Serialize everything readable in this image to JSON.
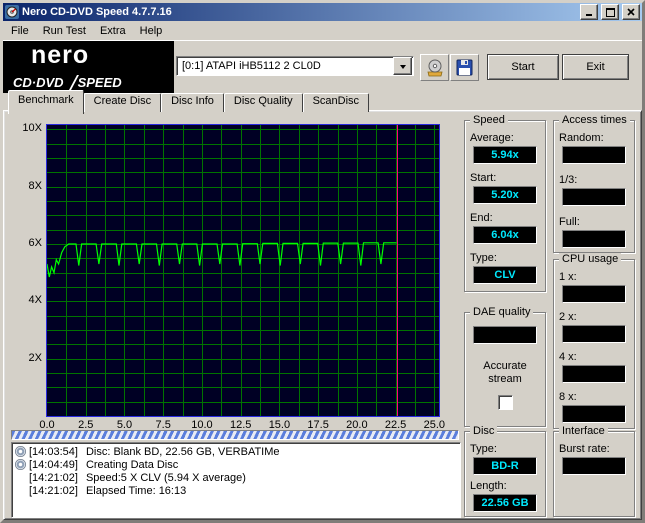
{
  "window": {
    "title": "Nero CD-DVD Speed 4.7.7.16"
  },
  "menu": {
    "items": [
      "File",
      "Run Test",
      "Extra",
      "Help"
    ]
  },
  "toolbar": {
    "logo": {
      "brand": "nero",
      "product_left": "CD·DVD",
      "product_right": "SPEED"
    },
    "drive_select": {
      "value": "[0:1]  ATAPI iHB5112  2 CL0D"
    },
    "buttons": {
      "start": "Start",
      "exit": "Exit"
    }
  },
  "tabs": [
    {
      "label": "Benchmark",
      "active": true
    },
    {
      "label": "Create Disc",
      "active": false
    },
    {
      "label": "Disc Info",
      "active": false
    },
    {
      "label": "Disc Quality",
      "active": false
    },
    {
      "label": "ScanDisc",
      "active": false
    }
  ],
  "chart_data": {
    "type": "line",
    "title": "",
    "xlabel": "",
    "ylabel": "",
    "xlim": [
      0,
      25.3
    ],
    "ylim": [
      0,
      10.15
    ],
    "x_ticks": [
      "0.0",
      "2.5",
      "5.0",
      "7.5",
      "10.0",
      "12.5",
      "15.0",
      "17.5",
      "20.0",
      "22.5",
      "25.0"
    ],
    "x_tick_values": [
      0,
      2.5,
      5,
      7.5,
      10,
      12.5,
      15,
      17.5,
      20,
      22.5,
      25
    ],
    "y_ticks": [
      "10X",
      "8X",
      "6X",
      "4X",
      "2X"
    ],
    "y_tick_values": [
      10,
      8,
      6,
      4,
      2
    ],
    "grid": {
      "x_step": 1.25,
      "y_step": 0.5,
      "on": true
    },
    "colors": {
      "bg": "#000024",
      "grid": "#007400",
      "marker": "#ff0080",
      "border": "#2a2ae0"
    },
    "marker_x": 22.56,
    "series": [
      {
        "name": "read speed (x)",
        "color": "#00ff00",
        "points": [
          [
            0,
            5.3
          ],
          [
            0.15,
            4.85
          ],
          [
            0.3,
            5.2
          ],
          [
            0.45,
            5.0
          ],
          [
            0.6,
            5.45
          ],
          [
            0.75,
            5.3
          ],
          [
            0.95,
            5.7
          ],
          [
            1.15,
            5.9
          ],
          [
            1.4,
            6.0
          ],
          [
            1.87,
            6.0
          ],
          [
            2.05,
            5.25
          ],
          [
            2.23,
            6.0
          ],
          [
            3.17,
            6.0
          ],
          [
            3.35,
            5.3
          ],
          [
            3.53,
            6.0
          ],
          [
            4.47,
            6.0
          ],
          [
            4.65,
            5.25
          ],
          [
            4.83,
            6.0
          ],
          [
            5.77,
            6.0
          ],
          [
            5.95,
            5.3
          ],
          [
            6.13,
            6.0
          ],
          [
            7.07,
            6.0
          ],
          [
            7.25,
            5.25
          ],
          [
            7.43,
            6.0
          ],
          [
            8.37,
            6.0
          ],
          [
            8.55,
            5.3
          ],
          [
            8.73,
            6.0
          ],
          [
            9.67,
            6.0
          ],
          [
            9.85,
            5.25
          ],
          [
            10.03,
            6.0
          ],
          [
            10.97,
            6.0
          ],
          [
            11.15,
            5.3
          ],
          [
            11.33,
            6.0
          ],
          [
            12.27,
            6.0
          ],
          [
            12.45,
            5.25
          ],
          [
            12.63,
            6.01
          ],
          [
            13.57,
            6.01
          ],
          [
            13.75,
            5.3
          ],
          [
            13.93,
            6.02
          ],
          [
            14.87,
            6.02
          ],
          [
            15.05,
            5.25
          ],
          [
            15.23,
            6.02
          ],
          [
            16.17,
            6.02
          ],
          [
            16.35,
            5.3
          ],
          [
            16.53,
            6.02
          ],
          [
            17.47,
            6.02
          ],
          [
            17.65,
            5.25
          ],
          [
            17.83,
            6.03
          ],
          [
            18.77,
            6.03
          ],
          [
            18.95,
            5.3
          ],
          [
            19.13,
            6.03
          ],
          [
            20.07,
            6.03
          ],
          [
            20.25,
            5.25
          ],
          [
            20.43,
            6.04
          ],
          [
            21.37,
            6.04
          ],
          [
            21.55,
            5.3
          ],
          [
            21.73,
            6.04
          ],
          [
            22.2,
            6.04
          ],
          [
            22.56,
            6.04
          ]
        ]
      }
    ]
  },
  "panels": {
    "speed": {
      "title": "Speed",
      "fields": [
        {
          "label": "Average:",
          "value": "5.94x"
        },
        {
          "label": "Start:",
          "value": "5.20x"
        },
        {
          "label": "End:",
          "value": "6.04x"
        },
        {
          "label": "Type:",
          "value": "CLV"
        }
      ]
    },
    "access_times": {
      "title": "Access times",
      "fields": [
        {
          "label": "Random:",
          "value": ""
        },
        {
          "label": "1/3:",
          "value": ""
        },
        {
          "label": "Full:",
          "value": ""
        }
      ]
    },
    "cpu_usage": {
      "title": "CPU usage",
      "fields": [
        {
          "label": "1 x:",
          "value": ""
        },
        {
          "label": "2 x:",
          "value": ""
        },
        {
          "label": "4 x:",
          "value": ""
        },
        {
          "label": "8 x:",
          "value": ""
        }
      ]
    },
    "dae_quality": {
      "title": "DAE quality",
      "value": "",
      "accurate_stream_label": "Accurate stream",
      "accurate_stream_checked": false
    },
    "disc": {
      "title": "Disc",
      "fields": [
        {
          "label": "Type:",
          "value": "BD-R"
        },
        {
          "label": "Length:",
          "value": "22.56 GB"
        }
      ]
    },
    "interface": {
      "title": "Interface",
      "fields": [
        {
          "label": "Burst rate:",
          "value": ""
        }
      ]
    }
  },
  "log": {
    "lines": [
      {
        "icon": true,
        "time": "[14:03:54]",
        "text": "Disc: Blank BD, 22.56 GB, VERBATIMe"
      },
      {
        "icon": true,
        "time": "[14:04:49]",
        "text": "Creating Data Disc"
      },
      {
        "icon": false,
        "time": "[14:21:02]",
        "text": "Speed:5 X CLV (5.94 X average)"
      },
      {
        "icon": false,
        "time": "[14:21:02]",
        "text": "Elapsed Time: 16:13"
      }
    ]
  }
}
